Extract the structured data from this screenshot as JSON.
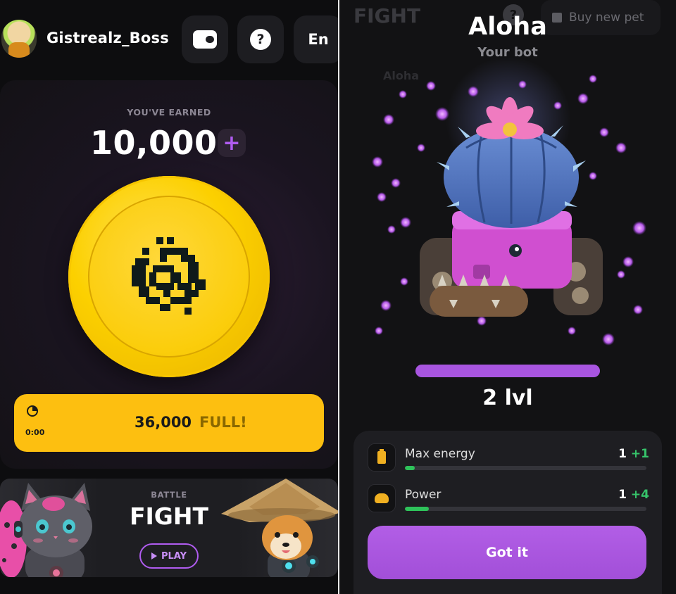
{
  "left": {
    "header": {
      "username": "Gistrealz_Boss",
      "language": "En",
      "help_glyph": "?"
    },
    "earnings": {
      "label": "YOU'VE EARNED",
      "value": "10,000",
      "plus_glyph": "+"
    },
    "energy": {
      "timer": "0:00",
      "value": "36,000",
      "status": "FULL!"
    },
    "battle": {
      "label": "BATTLE",
      "title": "FIGHT",
      "play_label": "PLAY"
    }
  },
  "right": {
    "background": {
      "title": "FIGHT",
      "help_glyph": "?",
      "buy_label": "Buy new pet",
      "faded_label": "Aloha"
    },
    "bot": {
      "name": "Aloha",
      "subtitle": "Your bot",
      "level": "2 lvl",
      "level_progress": 1.0
    },
    "stats": [
      {
        "name": "Max energy",
        "value": "1",
        "bonus": "+1",
        "progress": 0.04,
        "icon": "battery-icon"
      },
      {
        "name": "Power",
        "value": "1",
        "bonus": "+4",
        "progress": 0.1,
        "icon": "muscle-icon"
      }
    ],
    "confirm_label": "Got it"
  },
  "colors": {
    "accent_purple": "#a855e0",
    "coin_yellow": "#fcd000",
    "energy_yellow": "#fdbf10",
    "bonus_green": "#36c36a"
  }
}
